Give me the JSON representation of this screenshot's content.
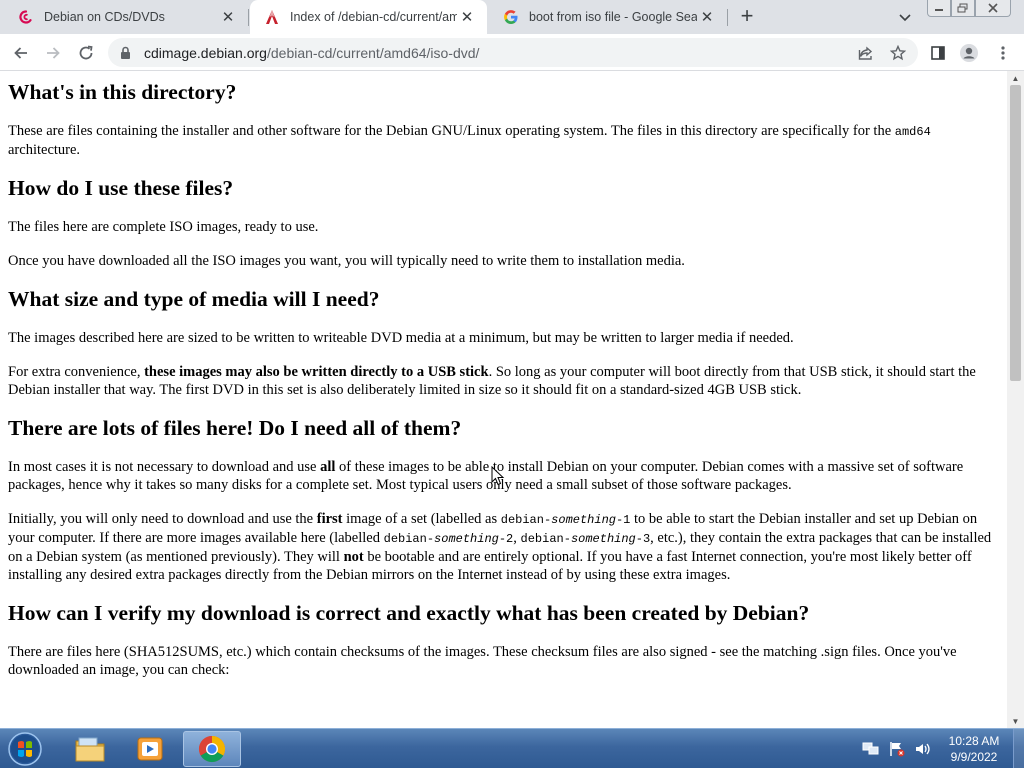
{
  "tabs": [
    {
      "title": "Debian on CDs/DVDs",
      "favicon": "debian-swirl-icon",
      "active": false
    },
    {
      "title": "Index of /debian-cd/current/amd",
      "favicon": "arch-a-icon",
      "active": true
    },
    {
      "title": "boot from iso file - Google Searc",
      "favicon": "google-g-icon",
      "active": false
    }
  ],
  "toolbar": {
    "url_host": "cdimage.debian.org",
    "url_path": "/debian-cd/current/amd64/iso-dvd/"
  },
  "content": {
    "h1": "What's in this directory?",
    "p1_a": "These are files containing the installer and other software for the Debian GNU/Linux operating system. The files in this directory are specifically for the ",
    "p1_code": "amd64",
    "p1_b": " architecture.",
    "h2": "How do I use these files?",
    "p2": "The files here are complete ISO images, ready to use.",
    "p3": "Once you have downloaded all the ISO images you want, you will typically need to write them to installation media.",
    "h3": "What size and type of media will I need?",
    "p4": "The images described here are sized to be written to writeable DVD media at a minimum, but may be written to larger media if needed.",
    "p5_a": "For extra convenience, ",
    "p5_bold": "these images may also be written directly to a USB stick",
    "p5_b": ". So long as your computer will boot directly from that USB stick, it should start the Debian installer that way. The first DVD in this set is also deliberately limited in size so it should fit on a standard-sized 4GB USB stick.",
    "h4": "There are lots of files here! Do I need all of them?",
    "p6_a": "In most cases it is not necessary to download and use ",
    "p6_bold": "all",
    "p6_b": " of these images to be able to install Debian on your computer. Debian comes with a massive set of software packages, hence why it takes so many disks for a complete set. Most typical users only need a small subset of those software packages.",
    "p7_a": "Initially, you will only need to download and use the ",
    "p7_bold1": "first",
    "p7_b": " image of a set (labelled as ",
    "p7_code1a": "debian-",
    "p7_code1b": "something",
    "p7_code1c": "-1",
    "p7_c": " to be able to start the Debian installer and set up Debian on your computer. If there are more images available here (labelled ",
    "p7_code2a": "debian-",
    "p7_code2b": "something",
    "p7_code2c": "-2",
    "p7_d": ", ",
    "p7_code3a": "debian-",
    "p7_code3b": "something",
    "p7_code3c": "-3",
    "p7_e": ", etc.), they contain the extra packages that can be installed on a Debian system (as mentioned previously). They will ",
    "p7_bold2": "not",
    "p7_f": " be bootable and are entirely optional. If you have a fast Internet connection, you're most likely better off installing any desired extra packages directly from the Debian mirrors on the Internet instead of by using these extra images.",
    "h5": "How can I verify my download is correct and exactly what has been created by Debian?",
    "p8": "There are files here (SHA512SUMS, etc.) which contain checksums of the images. These checksum files are also signed - see the matching .sign files. Once you've downloaded an image, you can check:"
  },
  "taskbar": {
    "apps": [
      "windows-explorer-icon",
      "media-player-icon",
      "chrome-icon"
    ],
    "tray": [
      "network-icon",
      "action-center-flag-icon",
      "volume-icon"
    ],
    "time": "10:28 AM",
    "date": "9/9/2022"
  }
}
